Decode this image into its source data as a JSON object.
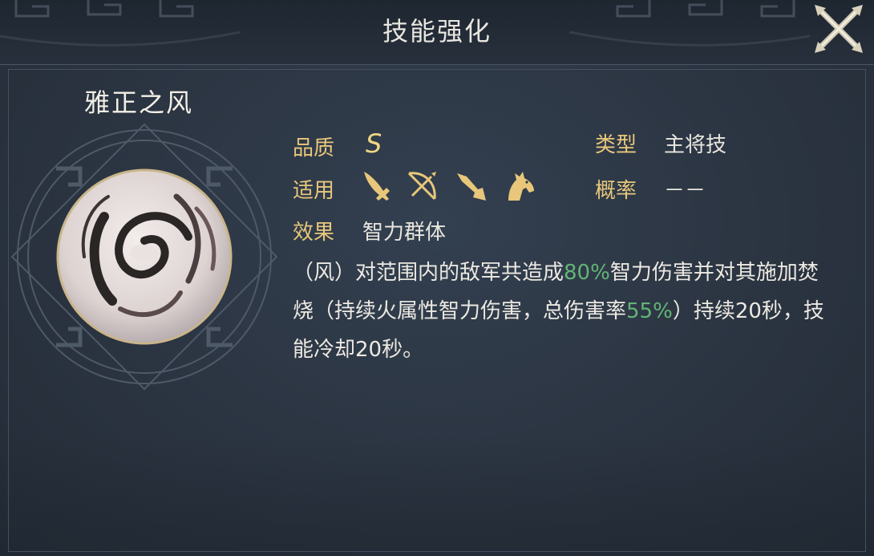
{
  "header": {
    "title": "技能强化"
  },
  "skill": {
    "name": "雅正之风",
    "quality_label": "品质",
    "quality_value": "S",
    "type_label": "类型",
    "type_value": "主将技",
    "applicable_label": "适用",
    "applicable_icons": [
      "sword-icon",
      "bow-icon",
      "spear-icon",
      "horse-icon"
    ],
    "chance_label": "概率",
    "chance_value": "－－",
    "effect_label": "效果",
    "effect_value": "智力群体",
    "description": {
      "part1": "（风）对范围内的敌军共造成",
      "pct1": "80%",
      "part2": "智力伤害并对其施加焚烧（持续火属性智力伤害，总伤害率",
      "pct2": "55%",
      "part3": "）持续20秒，技能冷却20秒。"
    }
  },
  "colors": {
    "label_gold": "#e8c77b",
    "highlight_green": "#63b476",
    "text_white": "#ece9e2"
  }
}
